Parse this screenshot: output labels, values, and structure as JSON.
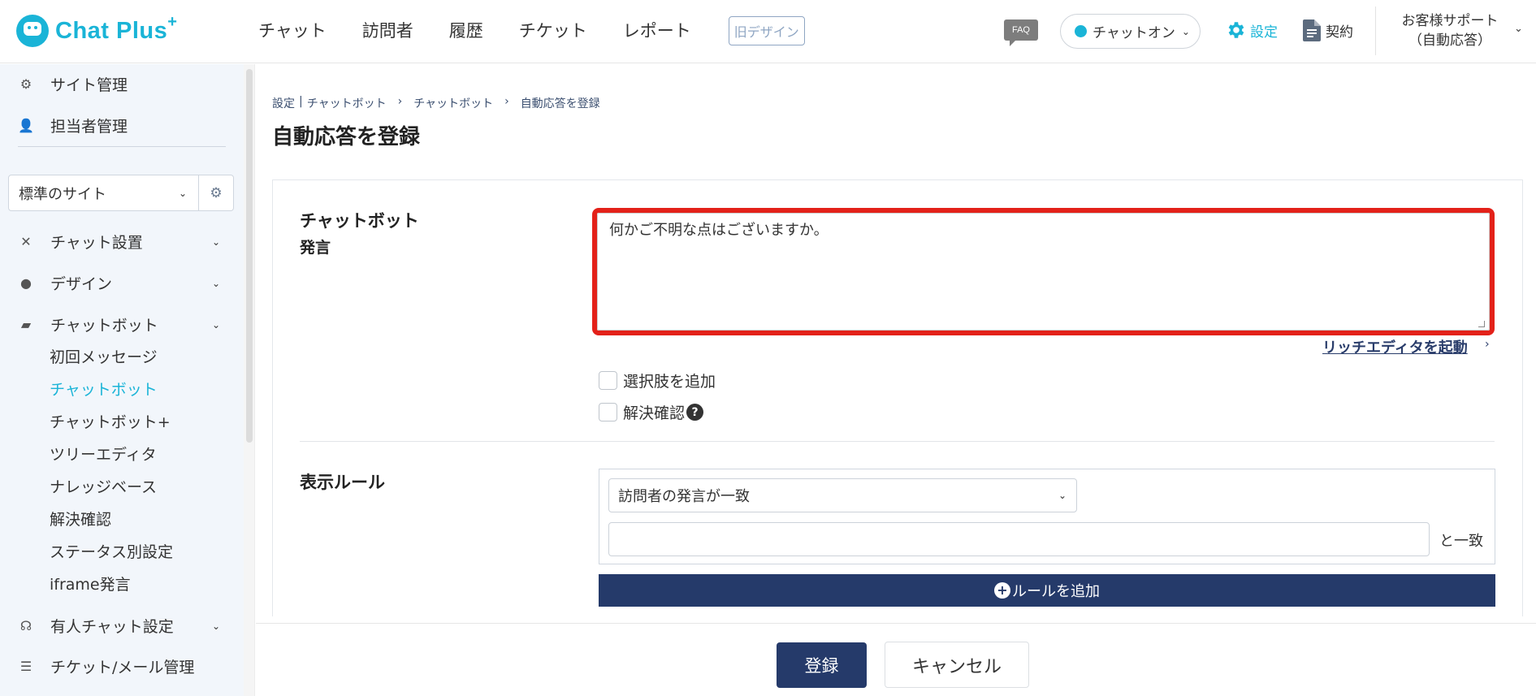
{
  "app": {
    "logo_text": "Chat Plus",
    "logo_sup": "+"
  },
  "header": {
    "nav": [
      "チャット",
      "訪問者",
      "履歴",
      "チケット",
      "レポート"
    ],
    "old_design": "旧デザイン",
    "faq": "FAQ",
    "status": "チャットオン",
    "settings": "設定",
    "contract": "契約",
    "support_line1": "お客様サポート",
    "support_line2": "（自動応答）"
  },
  "sidebar": {
    "top_items": [
      "サイト管理",
      "担当者管理"
    ],
    "site_select": "標準のサイト",
    "sections": [
      {
        "label": "チャット設置",
        "icon": "tools-icon"
      },
      {
        "label": "デザイン",
        "icon": "palette-icon"
      },
      {
        "label": "チャットボット",
        "icon": "chat-bubbles-icon"
      }
    ],
    "chatbot_sub": [
      "初回メッセージ",
      "チャットボット",
      "チャットボット+",
      "ツリーエディタ",
      "ナレッジベース",
      "解決確認",
      "ステータス別設定",
      "iframe発言"
    ],
    "active_sub": "チャットボット",
    "bottom_sections": [
      {
        "label": "有人チャット設定",
        "icon": "headset-icon"
      },
      {
        "label": "チケット/メール管理",
        "icon": "list-icon"
      }
    ]
  },
  "breadcrumb": [
    "設定",
    "|",
    "チャットボット",
    "›",
    "チャットボット",
    "›",
    "自動応答を登録"
  ],
  "page_title": "自動応答を登録",
  "form": {
    "speech_label_main": "チャットボット",
    "speech_label_sub": "発言",
    "speech_value": "何かご不明な点はございますか。",
    "rich_editor_link": "リッチエディタを起動",
    "add_choice_label": "選択肢を追加",
    "resolve_label": "解決確認",
    "rule_label": "表示ルール",
    "rule_select_value": "訪問者の発言が一致",
    "rule_input_value": "",
    "rule_suffix": "と一致",
    "add_rule_button": "ルールを追加"
  },
  "footer": {
    "submit": "登録",
    "cancel": "キャンセル"
  },
  "colors": {
    "accent": "#1ab4d7",
    "navy": "#253a6a",
    "highlight": "#e32119",
    "sidebar_bg": "#f2f6fb"
  }
}
